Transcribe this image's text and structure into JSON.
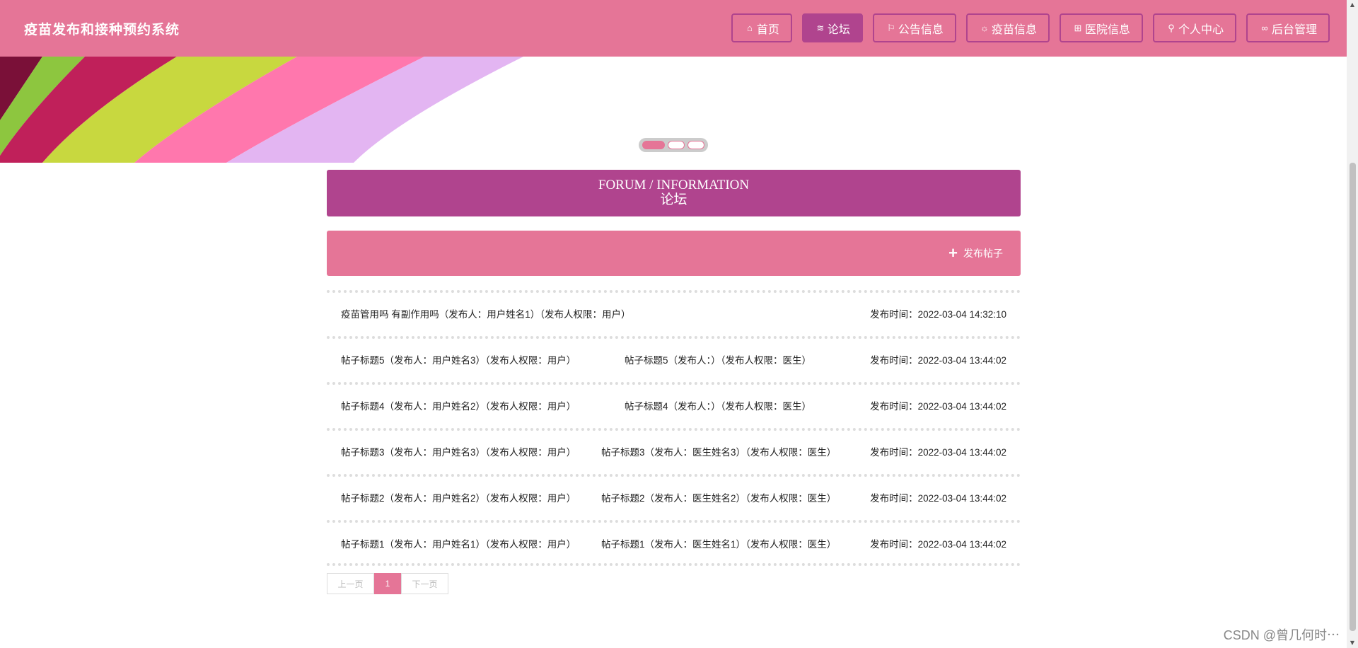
{
  "header": {
    "title": "疫苗发布和接种预约系统",
    "nav": [
      {
        "label": "首页",
        "icon": "home-icon",
        "glyph": "⌂",
        "active": false
      },
      {
        "label": "论坛",
        "icon": "layers-icon",
        "glyph": "≋",
        "active": true
      },
      {
        "label": "公告信息",
        "icon": "flag-icon",
        "glyph": "⚐",
        "active": false
      },
      {
        "label": "疫苗信息",
        "icon": "sun-icon",
        "glyph": "☼",
        "active": false
      },
      {
        "label": "医院信息",
        "icon": "gift-icon",
        "glyph": "⊞",
        "active": false
      },
      {
        "label": "个人中心",
        "icon": "user-icon",
        "glyph": "⚲",
        "active": false
      },
      {
        "label": "后台管理",
        "icon": "link-icon",
        "glyph": "∞",
        "active": false
      }
    ]
  },
  "forum": {
    "title_en": "FORUM / INFORMATION",
    "title_cn": "论坛",
    "publish_label": "发布帖子",
    "posts": [
      {
        "left": "疫苗管用吗 有副作用吗（发布人：用户姓名1）（发布人权限：用户）",
        "mid": "",
        "time": "发布时间：2022-03-04 14:32:10"
      },
      {
        "left": "帖子标题5（发布人：用户姓名3）（发布人权限：用户）",
        "mid": "帖子标题5（发布人：）（发布人权限：医生）",
        "time": "发布时间：2022-03-04 13:44:02"
      },
      {
        "left": "帖子标题4（发布人：用户姓名2）（发布人权限：用户）",
        "mid": "帖子标题4（发布人：）（发布人权限：医生）",
        "time": "发布时间：2022-03-04 13:44:02"
      },
      {
        "left": "帖子标题3（发布人：用户姓名3）（发布人权限：用户）",
        "mid": "帖子标题3（发布人：医生姓名3）（发布人权限：医生）",
        "time": "发布时间：2022-03-04 13:44:02"
      },
      {
        "left": "帖子标题2（发布人：用户姓名2）（发布人权限：用户）",
        "mid": "帖子标题2（发布人：医生姓名2）（发布人权限：医生）",
        "time": "发布时间：2022-03-04 13:44:02"
      },
      {
        "left": "帖子标题1（发布人：用户姓名1）（发布人权限：用户）",
        "mid": "帖子标题1（发布人：医生姓名1）（发布人权限：医生）",
        "time": "发布时间：2022-03-04 13:44:02"
      }
    ]
  },
  "pager": {
    "prev": "上一页",
    "current": "1",
    "next": "下一页"
  },
  "watermark": "CSDN @曾几何时⋯",
  "colors": {
    "header_bg": "#e57597",
    "accent": "#b0448e"
  }
}
